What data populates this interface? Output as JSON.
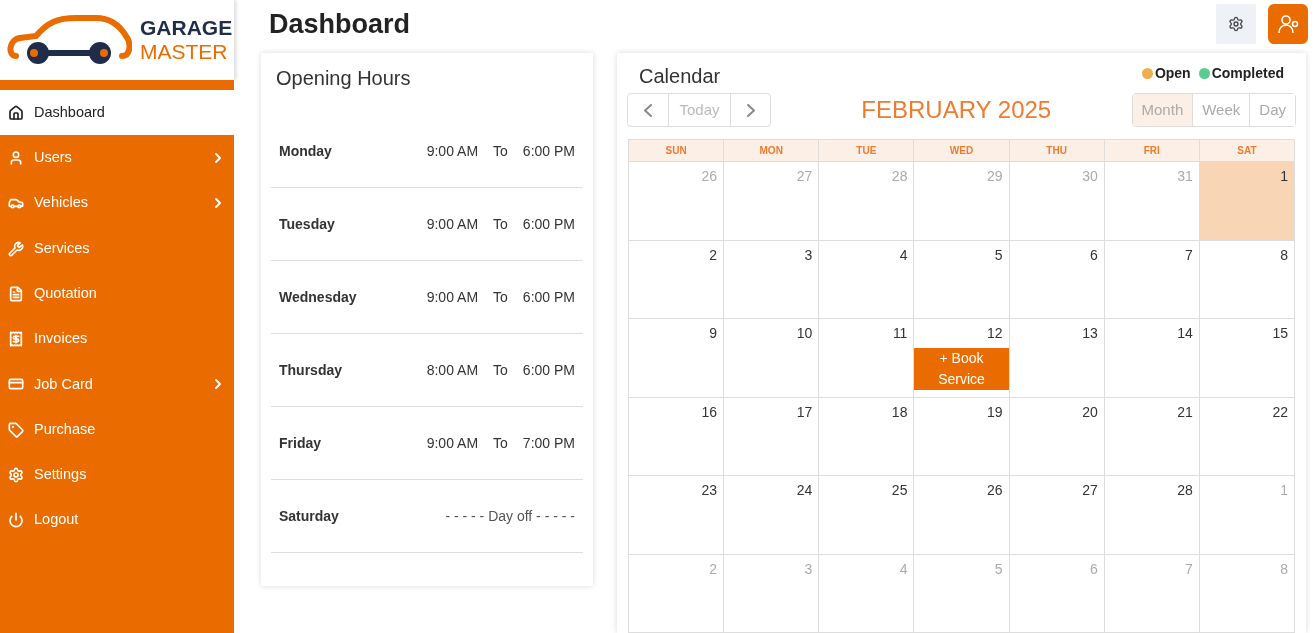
{
  "logo": {
    "line1": "GARAGE",
    "line2": "MASTER"
  },
  "sidebar": {
    "items": [
      {
        "label": "Dashboard",
        "selected": true,
        "expandable": false
      },
      {
        "label": "Users",
        "selected": false,
        "expandable": true
      },
      {
        "label": "Vehicles",
        "selected": false,
        "expandable": true
      },
      {
        "label": "Services",
        "selected": false,
        "expandable": false
      },
      {
        "label": "Quotation",
        "selected": false,
        "expandable": false
      },
      {
        "label": "Invoices",
        "selected": false,
        "expandable": false
      },
      {
        "label": "Job Card",
        "selected": false,
        "expandable": true
      },
      {
        "label": "Purchase",
        "selected": false,
        "expandable": false
      },
      {
        "label": "Settings",
        "selected": false,
        "expandable": false
      },
      {
        "label": "Logout",
        "selected": false,
        "expandable": false
      }
    ]
  },
  "header": {
    "title": "Dashboard"
  },
  "opening_hours": {
    "title": "Opening Hours",
    "rows": [
      {
        "kind": "hours",
        "day": "Monday",
        "open": "9:00 AM",
        "sep": "To",
        "close": "6:00 PM"
      },
      {
        "kind": "hours",
        "day": "Tuesday",
        "open": "9:00 AM",
        "sep": "To",
        "close": "6:00 PM"
      },
      {
        "kind": "hours",
        "day": "Wednesday",
        "open": "9:00 AM",
        "sep": "To",
        "close": "6:00 PM"
      },
      {
        "kind": "hours",
        "day": "Thursday",
        "open": "8:00 AM",
        "sep": "To",
        "close": "6:00 PM"
      },
      {
        "kind": "hours",
        "day": "Friday",
        "open": "9:00 AM",
        "sep": "To",
        "close": "7:00 PM"
      },
      {
        "kind": "off",
        "day": "Saturday",
        "note": "- - - - - Day off - - - - -"
      }
    ]
  },
  "calendar": {
    "title": "Calendar",
    "legend": [
      {
        "label": "Open",
        "color": "#f0ad4e"
      },
      {
        "label": "Completed",
        "color": "#5cc98f"
      }
    ],
    "nav": {
      "today": "Today"
    },
    "month": "FEBRUARY 2025",
    "views": [
      {
        "label": "Month",
        "selected": true
      },
      {
        "label": "Week",
        "selected": false
      },
      {
        "label": "Day",
        "selected": false
      }
    ],
    "weekdays": [
      "SUN",
      "MON",
      "TUE",
      "WED",
      "THU",
      "FRI",
      "SAT"
    ],
    "weeks": [
      [
        {
          "n": "26",
          "muted": true,
          "today": false
        },
        {
          "n": "27",
          "muted": true,
          "today": false
        },
        {
          "n": "28",
          "muted": true,
          "today": false
        },
        {
          "n": "29",
          "muted": true,
          "today": false
        },
        {
          "n": "30",
          "muted": true,
          "today": false
        },
        {
          "n": "31",
          "muted": true,
          "today": false
        },
        {
          "n": "1",
          "muted": false,
          "today": true
        }
      ],
      [
        {
          "n": "2",
          "muted": false,
          "today": false
        },
        {
          "n": "3",
          "muted": false,
          "today": false
        },
        {
          "n": "4",
          "muted": false,
          "today": false
        },
        {
          "n": "5",
          "muted": false,
          "today": false
        },
        {
          "n": "6",
          "muted": false,
          "today": false
        },
        {
          "n": "7",
          "muted": false,
          "today": false
        },
        {
          "n": "8",
          "muted": false,
          "today": false
        }
      ],
      [
        {
          "n": "9",
          "muted": false,
          "today": false
        },
        {
          "n": "10",
          "muted": false,
          "today": false
        },
        {
          "n": "11",
          "muted": false,
          "today": false
        },
        {
          "n": "12",
          "muted": false,
          "today": false,
          "action": "+ Book Service"
        },
        {
          "n": "13",
          "muted": false,
          "today": false
        },
        {
          "n": "14",
          "muted": false,
          "today": false
        },
        {
          "n": "15",
          "muted": false,
          "today": false
        }
      ],
      [
        {
          "n": "16",
          "muted": false,
          "today": false
        },
        {
          "n": "17",
          "muted": false,
          "today": false
        },
        {
          "n": "18",
          "muted": false,
          "today": false
        },
        {
          "n": "19",
          "muted": false,
          "today": false
        },
        {
          "n": "20",
          "muted": false,
          "today": false
        },
        {
          "n": "21",
          "muted": false,
          "today": false
        },
        {
          "n": "22",
          "muted": false,
          "today": false
        }
      ],
      [
        {
          "n": "23",
          "muted": false,
          "today": false
        },
        {
          "n": "24",
          "muted": false,
          "today": false
        },
        {
          "n": "25",
          "muted": false,
          "today": false
        },
        {
          "n": "26",
          "muted": false,
          "today": false
        },
        {
          "n": "27",
          "muted": false,
          "today": false
        },
        {
          "n": "28",
          "muted": false,
          "today": false
        },
        {
          "n": "1",
          "muted": true,
          "today": false
        }
      ],
      [
        {
          "n": "2",
          "muted": true,
          "today": false
        },
        {
          "n": "3",
          "muted": true,
          "today": false
        },
        {
          "n": "4",
          "muted": true,
          "today": false
        },
        {
          "n": "5",
          "muted": true,
          "today": false
        },
        {
          "n": "6",
          "muted": true,
          "today": false
        },
        {
          "n": "7",
          "muted": true,
          "today": false
        },
        {
          "n": "8",
          "muted": true,
          "today": false
        }
      ]
    ]
  }
}
